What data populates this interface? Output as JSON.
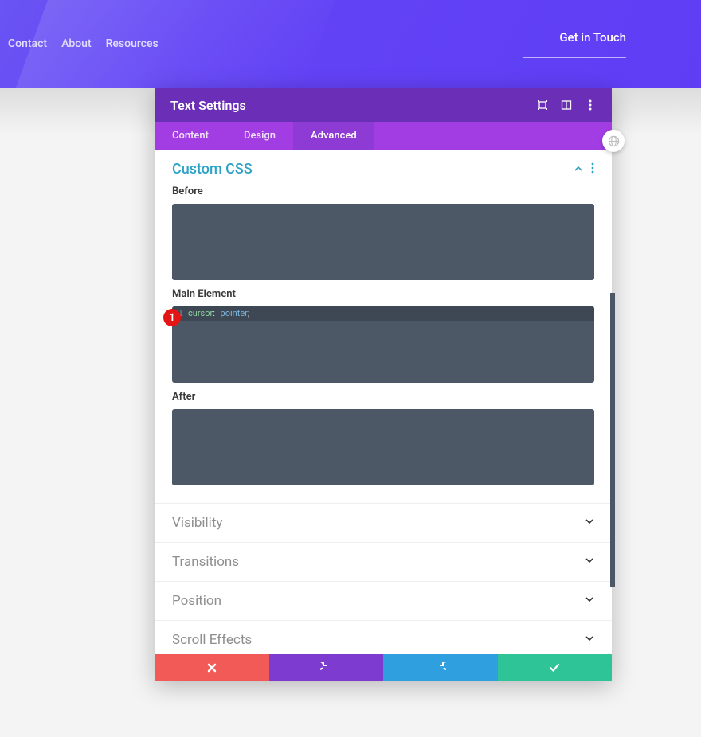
{
  "nav": {
    "contact": "Contact",
    "about": "About",
    "resources": "Resources",
    "cta": "Get in Touch"
  },
  "panel": {
    "title": "Text Settings",
    "tabs": {
      "content": "Content",
      "design": "Design",
      "advanced": "Advanced"
    },
    "customCss": {
      "heading": "Custom CSS",
      "before_label": "Before",
      "main_label": "Main Element",
      "after_label": "After",
      "code": {
        "line_num": "1",
        "prop": "cursor",
        "cursor_value": "pointer"
      }
    },
    "sections": {
      "visibility": "Visibility",
      "transitions": "Transitions",
      "position": "Position",
      "scrollEffects": "Scroll Effects"
    }
  },
  "annotation": {
    "badge": "1"
  }
}
